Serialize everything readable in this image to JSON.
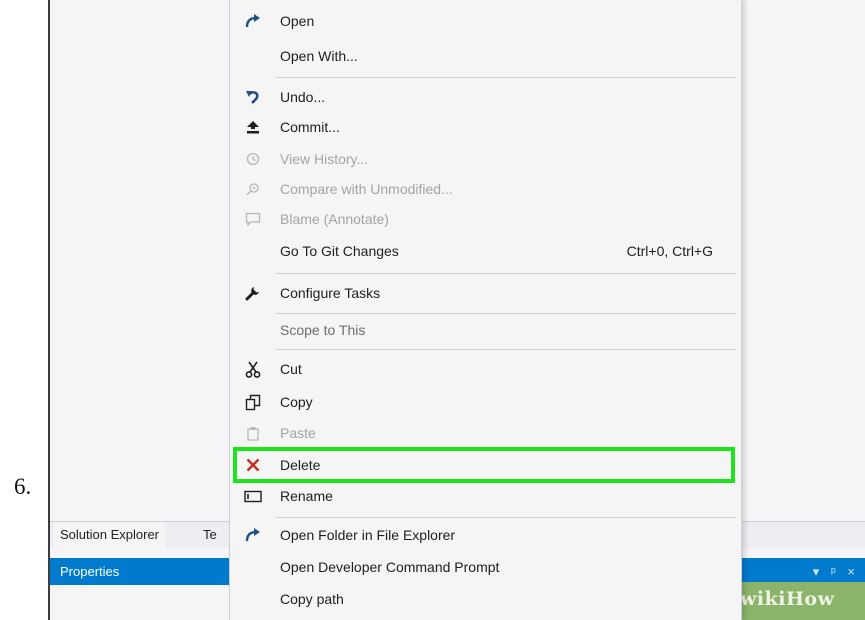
{
  "step_number": "6.",
  "menu": {
    "items": [
      {
        "label": "Open",
        "icon": "redo-arrow-icon",
        "shortcut": "",
        "disabled": false
      },
      {
        "label": "Open With...",
        "icon": "",
        "shortcut": "",
        "disabled": false
      },
      {
        "label": "Undo...",
        "icon": "undo-icon",
        "shortcut": "",
        "disabled": false
      },
      {
        "label": "Commit...",
        "icon": "upload-icon",
        "shortcut": "",
        "disabled": false
      },
      {
        "label": "View History...",
        "icon": "history-icon",
        "shortcut": "",
        "disabled": true
      },
      {
        "label": "Compare with Unmodified...",
        "icon": "compare-icon",
        "shortcut": "",
        "disabled": true
      },
      {
        "label": "Blame (Annotate)",
        "icon": "comment-icon",
        "shortcut": "",
        "disabled": true
      },
      {
        "label": "Go To Git Changes",
        "icon": "",
        "shortcut": "Ctrl+0, Ctrl+G",
        "disabled": false
      },
      {
        "label": "Configure Tasks",
        "icon": "wrench-icon",
        "shortcut": "",
        "disabled": false
      },
      {
        "label": "Scope to This",
        "icon": "",
        "shortcut": "",
        "disabled": false
      },
      {
        "label": "Cut",
        "icon": "scissors-icon",
        "shortcut": "",
        "disabled": false
      },
      {
        "label": "Copy",
        "icon": "copy-icon",
        "shortcut": "",
        "disabled": false
      },
      {
        "label": "Paste",
        "icon": "paste-icon",
        "shortcut": "",
        "disabled": true
      },
      {
        "label": "Delete",
        "icon": "delete-x-icon",
        "shortcut": "",
        "disabled": false,
        "highlighted": true
      },
      {
        "label": "Rename",
        "icon": "rename-icon",
        "shortcut": "",
        "disabled": false
      },
      {
        "label": "Open Folder in File Explorer",
        "icon": "redo-arrow-icon",
        "shortcut": "",
        "disabled": false
      },
      {
        "label": "Open Developer Command Prompt",
        "icon": "",
        "shortcut": "",
        "disabled": false
      },
      {
        "label": "Copy path",
        "icon": "",
        "shortcut": "",
        "disabled": false
      }
    ]
  },
  "bottom_tabs": {
    "solution_explorer": "Solution Explorer",
    "partial_tab": "Te"
  },
  "properties": {
    "title": "Properties",
    "controls": "▾ ᵖ ×"
  },
  "watermark": "wikiHow",
  "colors": {
    "highlight": "#1ee41e",
    "accent": "#007acc",
    "delete_icon": "#c42b1c",
    "watermark": "#8bb46a"
  }
}
